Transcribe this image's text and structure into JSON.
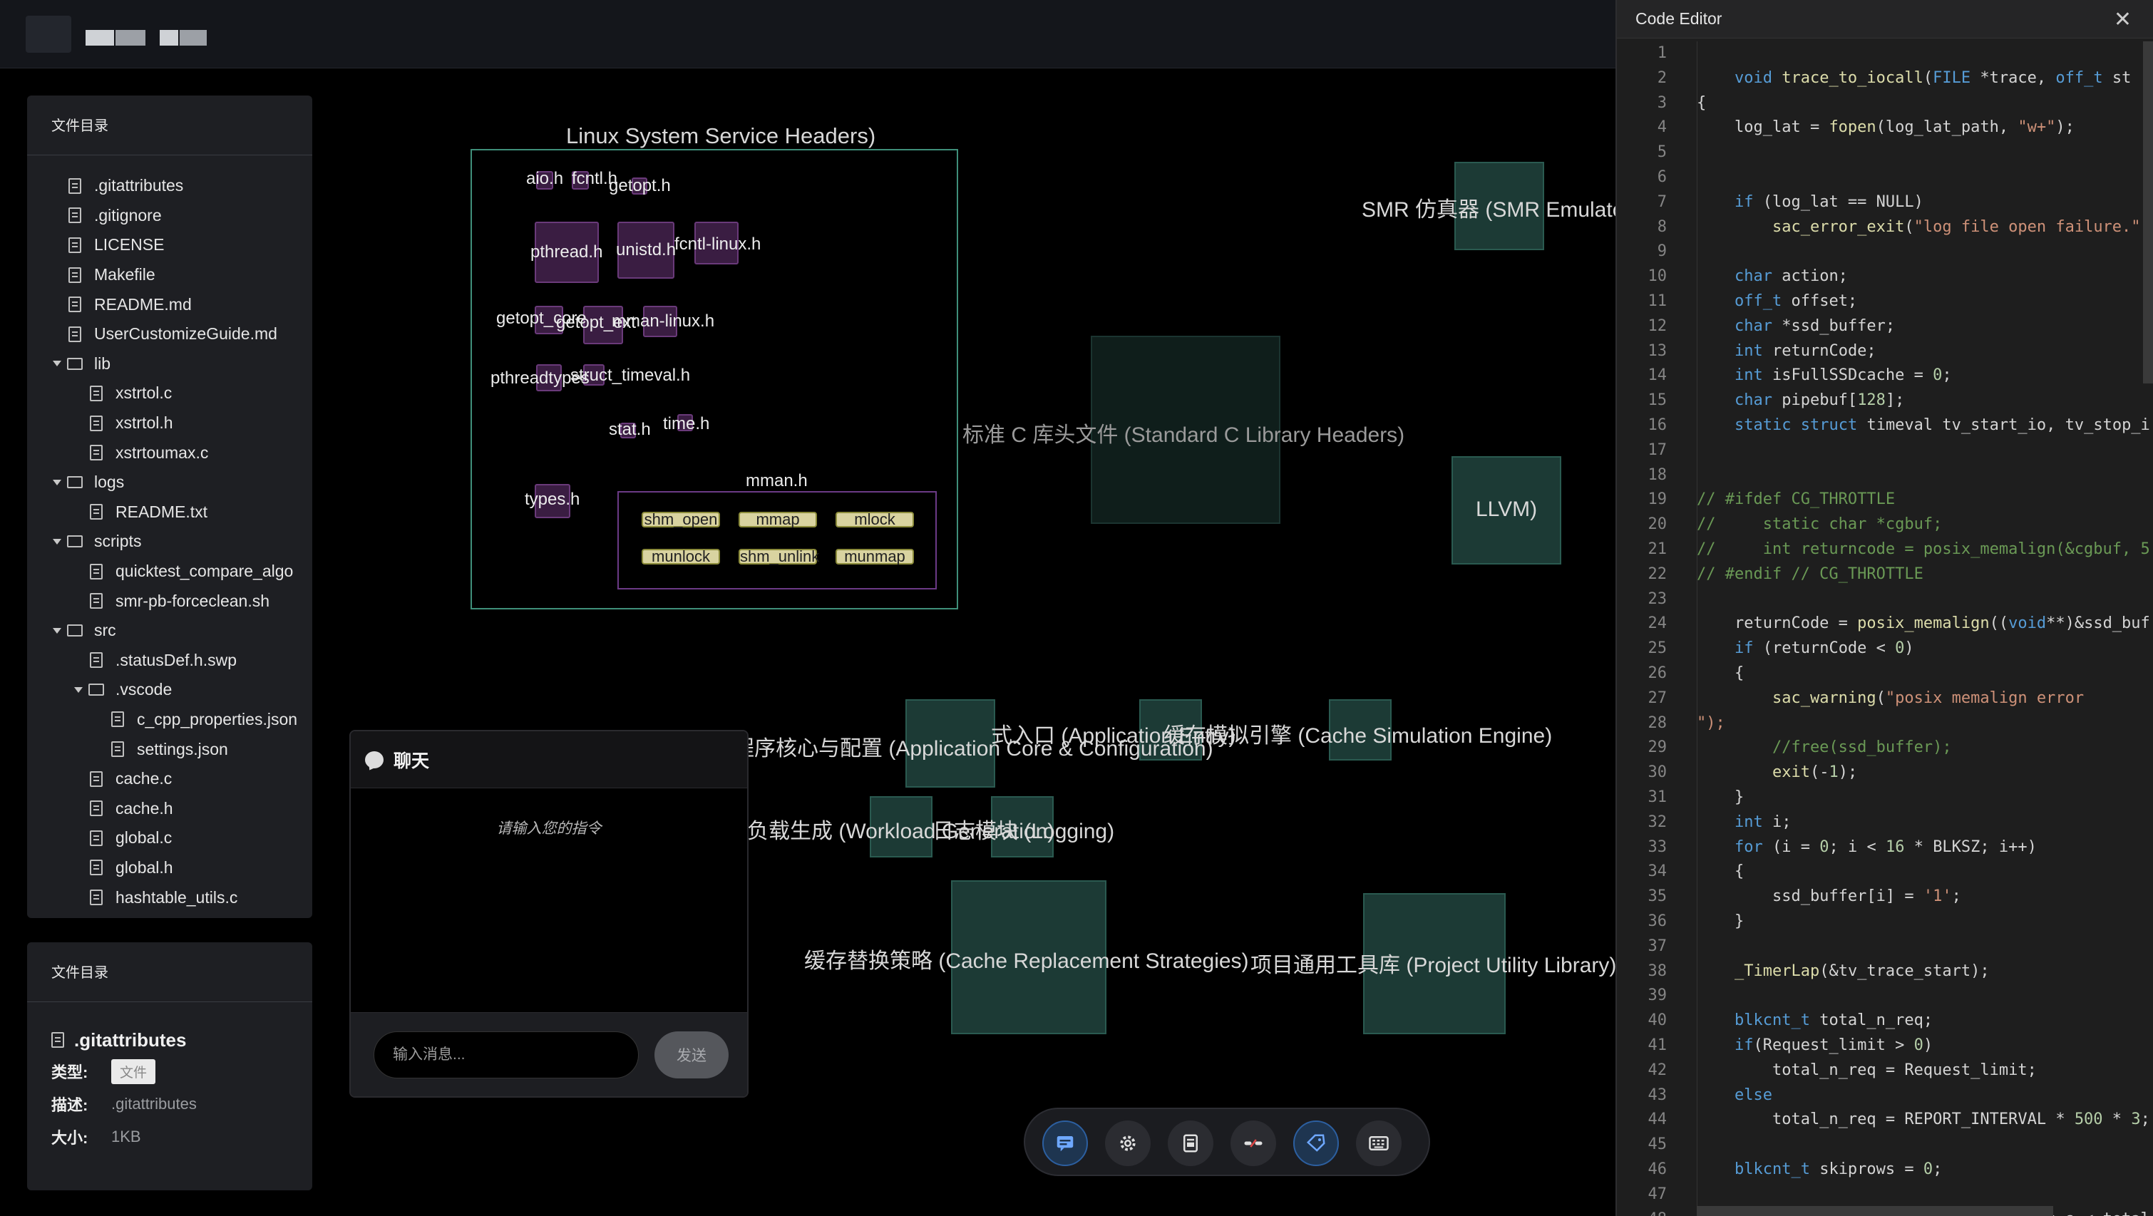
{
  "filetree": {
    "title": "文件目录",
    "items": [
      {
        "label": ".gitattributes",
        "type": "file",
        "depth": 0
      },
      {
        "label": ".gitignore",
        "type": "file",
        "depth": 0
      },
      {
        "label": "LICENSE",
        "type": "file",
        "depth": 0
      },
      {
        "label": "Makefile",
        "type": "file",
        "depth": 0
      },
      {
        "label": "README.md",
        "type": "file",
        "depth": 0
      },
      {
        "label": "UserCustomizeGuide.md",
        "type": "file",
        "depth": 0
      },
      {
        "label": "lib",
        "type": "folder",
        "depth": 0
      },
      {
        "label": "xstrtol.c",
        "type": "file",
        "depth": 1
      },
      {
        "label": "xstrtol.h",
        "type": "file",
        "depth": 1
      },
      {
        "label": "xstrtoumax.c",
        "type": "file",
        "depth": 1
      },
      {
        "label": "logs",
        "type": "folder",
        "depth": 0
      },
      {
        "label": "README.txt",
        "type": "file",
        "depth": 1
      },
      {
        "label": "scripts",
        "type": "folder",
        "depth": 0
      },
      {
        "label": "quicktest_compare_algo",
        "type": "file",
        "depth": 1
      },
      {
        "label": "smr-pb-forceclean.sh",
        "type": "file",
        "depth": 1
      },
      {
        "label": "src",
        "type": "folder",
        "depth": 0
      },
      {
        "label": ".statusDef.h.swp",
        "type": "file",
        "depth": 1
      },
      {
        "label": ".vscode",
        "type": "folder",
        "depth": 1
      },
      {
        "label": "c_cpp_properties.json",
        "type": "file",
        "depth": 2
      },
      {
        "label": "settings.json",
        "type": "file",
        "depth": 2
      },
      {
        "label": "cache.c",
        "type": "file",
        "depth": 1
      },
      {
        "label": "cache.h",
        "type": "file",
        "depth": 1
      },
      {
        "label": "global.c",
        "type": "file",
        "depth": 1
      },
      {
        "label": "global.h",
        "type": "file",
        "depth": 1
      },
      {
        "label": "hashtable_utils.c",
        "type": "file",
        "depth": 1
      }
    ]
  },
  "detail": {
    "title": "文件目录",
    "name": ".gitattributes",
    "type_label": "类型:",
    "type_value": "文件",
    "desc_label": "描述:",
    "desc_value": ".gitattributes",
    "size_label": "大小:",
    "size_value": "1KB"
  },
  "graph": {
    "group_title": "Linux System Service Headers)",
    "headers": {
      "aio": "aio.h",
      "fcntl": "fcntl.h",
      "getopt": "getopt.h",
      "pthread": "pthread.h",
      "unistd": "unistd.h",
      "fcntl_linux": "fcntl-linux.h",
      "getopt_core": "getopt_core",
      "getopt_ext": "getopt_ext",
      "mman_linux": "mman-linux.h",
      "pthreadtypes": "pthreadtypes",
      "struct_timeval": "struct_timeval.h",
      "stat": "stat.h",
      "time": "time.h",
      "types": "types.h",
      "mman": "mman.h"
    },
    "mman_funcs": [
      "shm_open",
      "mmap",
      "mlock",
      "munlock",
      "shm_unlink",
      "munmap"
    ],
    "modules": {
      "smr": "SMR 仿真器 (SMR Emulator",
      "stdc": "标准 C 库头文件 (Standard C Library Headers)",
      "llvm": "LLVM)",
      "core": "程序核心与配置 (Application Core & Configuration)",
      "entry": "式入口 (Application Entry)",
      "cache_sim": "缓存模拟引擎 (Cache Simulation Engine)",
      "workload": "负载生成 (Workload Generation)",
      "logging": "日志模块 (Logging)",
      "replacement": "缓存替换策略 (Cache Replacement Strategies)",
      "utility": "项目通用工具库 (Project Utility Library)"
    }
  },
  "chat": {
    "title": "聊天",
    "placeholder_text": "请输入您的指令",
    "input_placeholder": "输入消息...",
    "send_label": "发送"
  },
  "toolbar": {
    "buttons": [
      "chat-icon",
      "gear-icon",
      "document-icon",
      "link-broken-icon",
      "tag-icon",
      "keyboard-icon"
    ]
  },
  "editor": {
    "title": "Code Editor",
    "close": "✕",
    "lines": [
      "",
      "    void trace_to_iocall(FILE *trace, off_t st",
      "{",
      "    log_lat = fopen(log_lat_path, \"w+\");",
      "",
      "",
      "    if (log_lat == NULL)",
      "        sac_error_exit(\"log file open failure.\")",
      "",
      "    char action;",
      "    off_t offset;",
      "    char *ssd_buffer;",
      "    int returnCode;",
      "    int isFullSSDcache = 0;",
      "    char pipebuf[128];",
      "    static struct timeval tv_start_io, tv_stop_i",
      "",
      "",
      "// #ifdef CG_THROTTLE",
      "//     static char *cgbuf;",
      "//     int returncode = posix_memalign(&cgbuf, 5",
      "// #endif // CG_THROTTLE",
      "",
      "    returnCode = posix_memalign((void**)&ssd_buf",
      "    if (returnCode < 0)",
      "    {",
      "        sac_warning(\"posix memalign error",
      "\");",
      "        //free(ssd_buffer);",
      "        exit(-1);",
      "    }",
      "    int i;",
      "    for (i = 0; i < 16 * BLKSZ; i++)",
      "    {",
      "        ssd_buffer[i] = '1';",
      "    }",
      "",
      "    _TimerLap(&tv_trace_start);",
      "",
      "    blkcnt_t total_n_req;",
      "    if(Request_limit > 0)",
      "        total_n_req = Request_limit;",
      "    else",
      "        total_n_req = REPORT_INTERVAL * 500 * 3;",
      "",
      "    blkcnt_t skiprows = 0;",
      "",
      "    while (!feof(trace) && STT->reqcnt_s < total",
      "    {"
    ]
  }
}
